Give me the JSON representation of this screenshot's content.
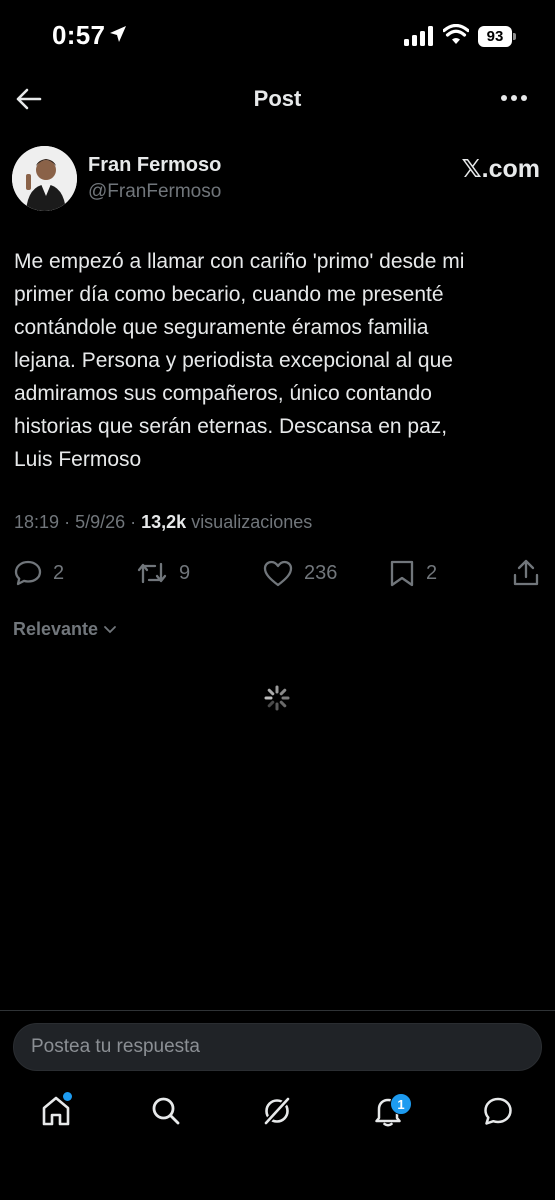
{
  "status_bar": {
    "time": "0:57",
    "battery": "93",
    "icons": [
      "location-arrow-icon",
      "signal-icon",
      "wifi-icon",
      "battery-icon"
    ]
  },
  "header": {
    "title": "Post",
    "icons": [
      "back-arrow-icon",
      "more-icon"
    ]
  },
  "post": {
    "author_name": "Fran Fermoso",
    "author_handle": "@FranFermoso",
    "source": "𝕏.com",
    "text": "Me empezó a llamar con cariño 'primo' desde mi\nprimer día como becario, cuando me presenté\ncontándole que seguramente éramos familia\nlejana. Persona y periodista excepcional al que\nadmiramos sus compañeros, único contando\nhistorias que serán eternas. Descansa en paz,\nLuis Fermoso",
    "time": "18:19",
    "date": "5/9/26",
    "views_count": "13,2k",
    "views_label": "visualizaciones"
  },
  "actions": {
    "replies": "2",
    "reposts": "9",
    "likes": "236",
    "bookmarks": "2",
    "icons": [
      "reply-icon",
      "repost-icon",
      "like-icon",
      "bookmark-icon",
      "share-icon"
    ]
  },
  "sort": {
    "label": "Relevante"
  },
  "reply": {
    "placeholder": "Postea tu respuesta"
  },
  "tabs": {
    "items": [
      "home",
      "search",
      "grok",
      "notifications",
      "messages"
    ],
    "notifications_badge": "1"
  },
  "colors": {
    "background": "#000000",
    "text": "#e7e9ea",
    "secondary": "#71767b",
    "accent": "#1d9bf0"
  }
}
